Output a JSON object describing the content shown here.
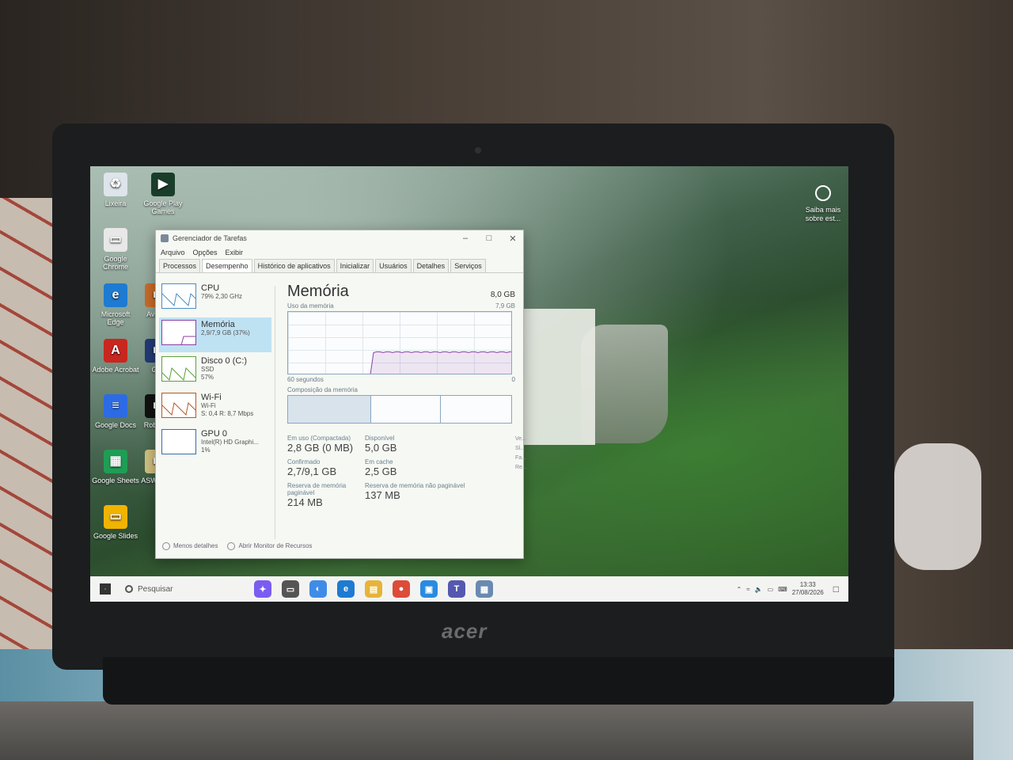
{
  "desktop": {
    "icons": [
      {
        "label": "Lixeira",
        "color": "#dde4ea",
        "glyph": "♻"
      },
      {
        "label": "Google Play Games",
        "color": "#1a3d2a",
        "glyph": "▶"
      },
      {
        "label": "Google Chrome",
        "color": "#e8e8e8",
        "glyph": "▭"
      },
      {
        "label": "Microsoft Edge",
        "color": "#1e7bd1",
        "glyph": "e"
      },
      {
        "label": "Adobe Acrobat",
        "color": "#c9261f",
        "glyph": "A"
      },
      {
        "label": "Google Docs",
        "color": "#2d6be4",
        "glyph": "≡"
      },
      {
        "label": "Google Sheets",
        "color": "#1f9d55",
        "glyph": "▦"
      },
      {
        "label": "Google Slides",
        "color": "#f0b400",
        "glyph": "▭"
      },
      {
        "label": "Avatar",
        "color": "#c86b2a",
        "glyph": "■"
      },
      {
        "label": "GP",
        "color": "#233a75",
        "glyph": "■"
      },
      {
        "label": "Rob Stu",
        "color": "#111",
        "glyph": "■"
      },
      {
        "label": "ASW Live",
        "color": "#d0c080",
        "glyph": "■"
      }
    ],
    "spotlight": {
      "label": "Saiba mais sobre est..."
    }
  },
  "task_manager": {
    "title": "Gerenciador de Tarefas",
    "menu": [
      "Arquivo",
      "Opções",
      "Exibir"
    ],
    "tabs": [
      "Processos",
      "Desempenho",
      "Histórico de aplicativos",
      "Inicializar",
      "Usuários",
      "Detalhes",
      "Serviços"
    ],
    "active_tab": "Desempenho",
    "sidebar": [
      {
        "name": "CPU",
        "sub1": "79% 2,30 GHz",
        "sub2": "",
        "selected": false,
        "color": "#4a8cc4"
      },
      {
        "name": "Memória",
        "sub1": "2,9/7,9 GB (37%)",
        "sub2": "",
        "selected": true,
        "color": "#8b3fa6"
      },
      {
        "name": "Disco 0 (C:)",
        "sub1": "SSD",
        "sub2": "57%",
        "selected": false,
        "color": "#5aa13b"
      },
      {
        "name": "Wi-Fi",
        "sub1": "Wi-Fi",
        "sub2": "S: 0,4 R: 8,7 Mbps",
        "selected": false,
        "color": "#b5582a"
      },
      {
        "name": "GPU 0",
        "sub1": "Intel(R) HD Graphi...",
        "sub2": "1%",
        "selected": false,
        "color": "#3a6ca8"
      }
    ],
    "main": {
      "title": "Memória",
      "total": "8,0 GB",
      "usage_label": "Uso da memória",
      "usage_max": "7,9 GB",
      "time_left": "60 segundos",
      "time_right": "0",
      "composition_label": "Composição da memória",
      "stats": [
        {
          "key": "Em uso (Compactada)",
          "value": "2,8 GB (0 MB)"
        },
        {
          "key": "Disponível",
          "value": "5,0 GB"
        },
        {
          "key": "Confirmado",
          "value": "2,7/9,1 GB"
        },
        {
          "key": "Em cache",
          "value": "2,5 GB"
        },
        {
          "key": "Reserva de memória paginável",
          "value": "214 MB"
        },
        {
          "key": "Reserva de memória não paginável",
          "value": "137 MB"
        }
      ],
      "side_keys": "Ve...\nSl...\nFa...\nRe...",
      "usage_fraction": 0.37
    },
    "footer": {
      "less_details": "Menos detalhes",
      "open_monitor": "Abrir Monitor de Recursos"
    }
  },
  "taskbar": {
    "search_placeholder": "Pesquisar",
    "apps": [
      {
        "name": "copilot",
        "color": "#7a5cf0",
        "glyph": "✦"
      },
      {
        "name": "task-view",
        "color": "#555",
        "glyph": "▭"
      },
      {
        "name": "copilot-app",
        "color": "#3f8ce8",
        "glyph": "◐"
      },
      {
        "name": "edge",
        "color": "#1e7bd1",
        "glyph": "e"
      },
      {
        "name": "explorer",
        "color": "#e6b43a",
        "glyph": "▤"
      },
      {
        "name": "chrome",
        "color": "#dd4b39",
        "glyph": "●"
      },
      {
        "name": "photos",
        "color": "#2a8be0",
        "glyph": "▣"
      },
      {
        "name": "teams",
        "color": "#5558af",
        "glyph": "T"
      },
      {
        "name": "task-manager",
        "color": "#6a8ab0",
        "glyph": "▦"
      }
    ],
    "time": "13:33",
    "date": "27/08/2026"
  }
}
